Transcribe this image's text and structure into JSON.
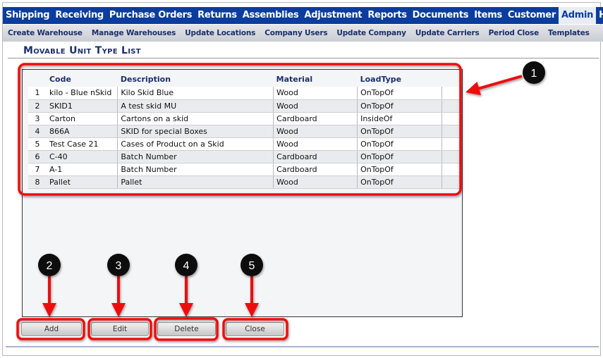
{
  "nav": {
    "items": [
      "Shipping",
      "Receiving",
      "Purchase Orders",
      "Returns",
      "Assemblies",
      "Adjustment",
      "Reports",
      "Documents",
      "Items",
      "Customer",
      "Admin",
      "H"
    ],
    "active": "Admin"
  },
  "subnav": {
    "items": [
      "Create Warehouse",
      "Manage Warehouses",
      "Update Locations",
      "Company Users",
      "Update Company",
      "Update Carriers",
      "Period Close",
      "Templates"
    ]
  },
  "page": {
    "title": "Movable Unit Type List"
  },
  "table": {
    "columns": [
      "",
      "Code",
      "Description",
      "Material",
      "LoadType"
    ],
    "rows": [
      [
        "1",
        "kilo - Blue nSkid",
        "Kilo Skid Blue",
        "Wood",
        "OnTopOf"
      ],
      [
        "2",
        "SKID1",
        "A test skid MU",
        "Wood",
        "OnTopOf"
      ],
      [
        "3",
        "Carton",
        "Cartons on a skid",
        "Cardboard",
        "InsideOf"
      ],
      [
        "4",
        "866A",
        "SKID for special Boxes",
        "Wood",
        "OnTopOf"
      ],
      [
        "5",
        "Test Case 21",
        "Cases of Product on a Skid",
        "Wood",
        "OnTopOf"
      ],
      [
        "6",
        "C-40",
        "Batch Number",
        "Cardboard",
        "OnTopOf"
      ],
      [
        "7",
        "A-1",
        "Batch Number",
        "Cardboard",
        "OnTopOf"
      ],
      [
        "8",
        "Pallet",
        "Pallet",
        "Wood",
        "OnTopOf"
      ]
    ]
  },
  "buttons": {
    "add": "Add",
    "edit": "Edit",
    "delete": "Delete",
    "close": "Close"
  },
  "annotations": [
    "1",
    "2",
    "3",
    "4",
    "5"
  ],
  "colors": {
    "nav": "#0a3d9e",
    "annotation": "#ee1111",
    "badge": "#111111"
  }
}
